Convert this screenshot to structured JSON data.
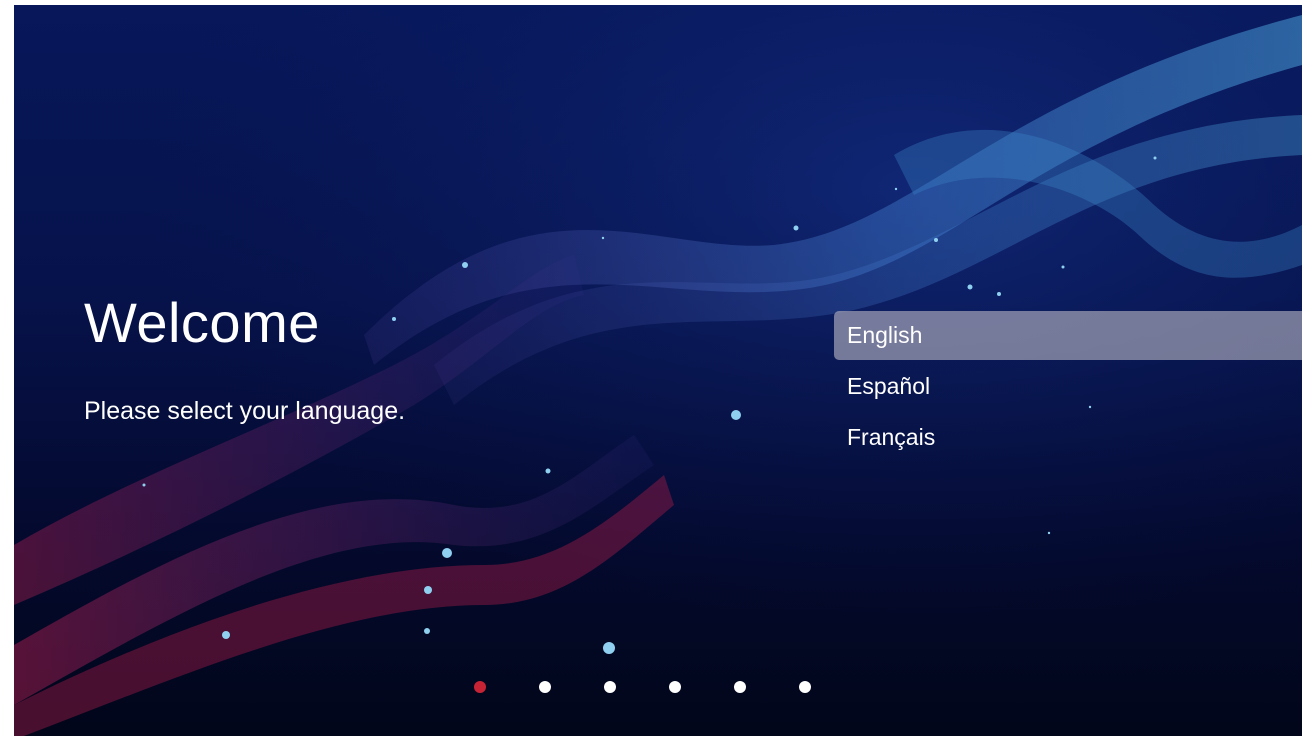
{
  "welcome": {
    "title": "Welcome",
    "subtitle": "Please select your language."
  },
  "languages": [
    {
      "label": "English",
      "selected": true
    },
    {
      "label": "Español",
      "selected": false
    },
    {
      "label": "Français",
      "selected": false
    }
  ],
  "pagination": {
    "total_steps": 6,
    "current_step": 1
  },
  "colors": {
    "background": "#06124a",
    "selection_highlight": "#a0a0b4",
    "active_dot": "#c62434",
    "inactive_dot": "#ffffff",
    "text": "#ffffff"
  }
}
